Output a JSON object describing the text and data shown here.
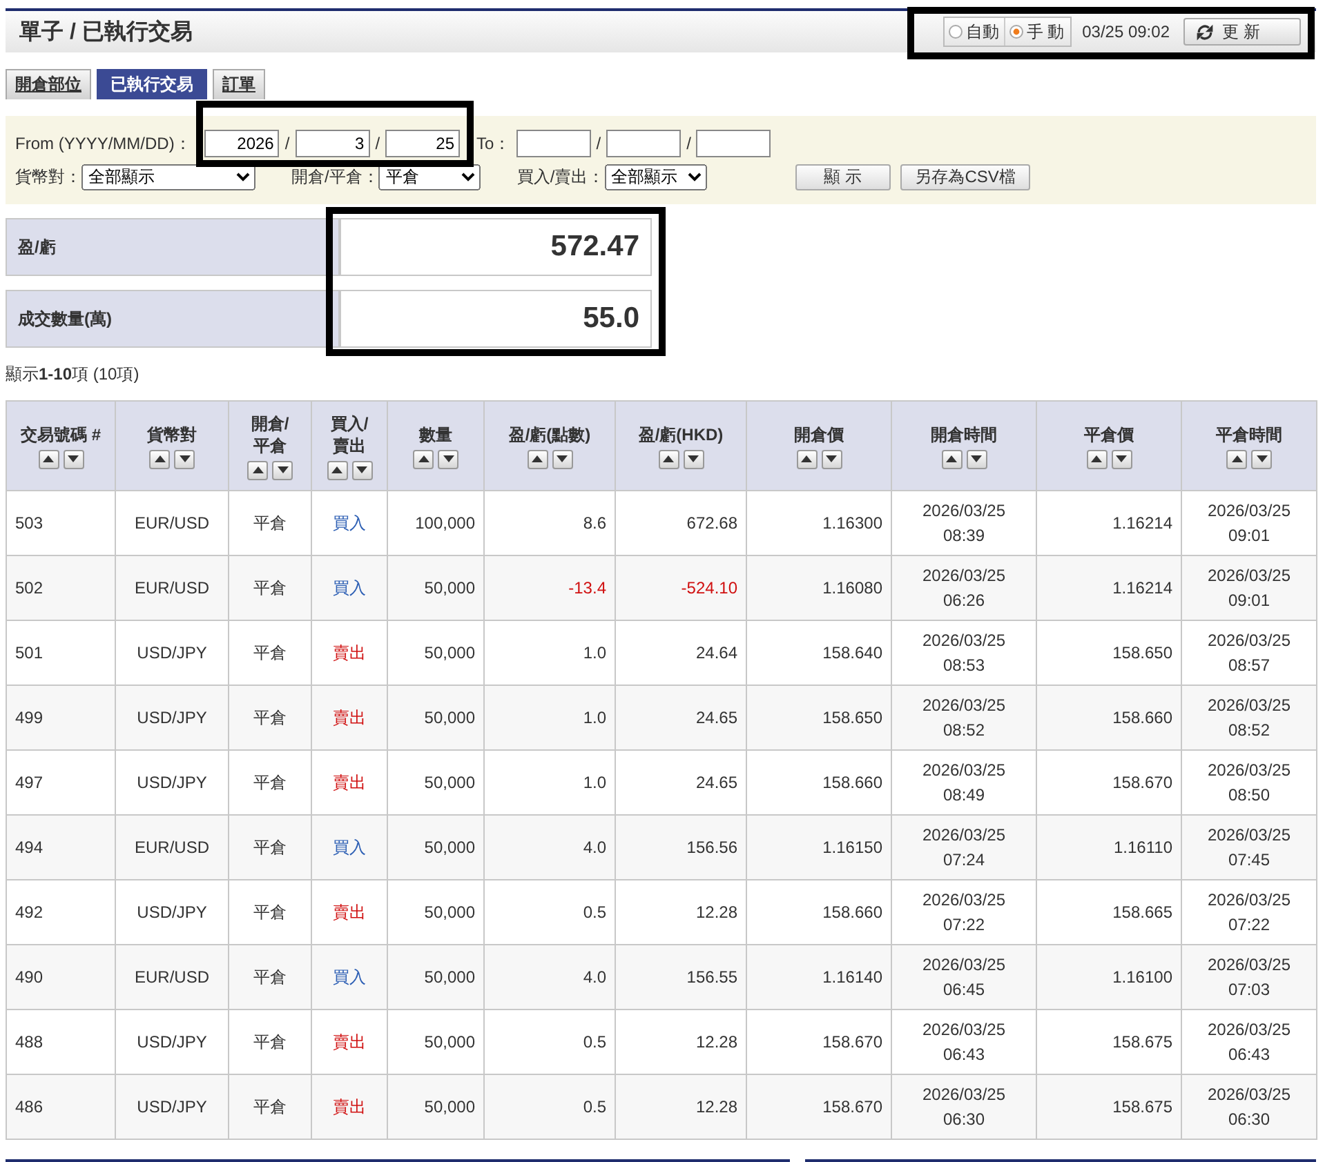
{
  "header": {
    "title": "單子 / 已執行交易",
    "controls": {
      "highlighted": true,
      "refresh_mode": [
        {
          "label": "自動",
          "selected": false
        },
        {
          "label": "手 動",
          "selected": true
        }
      ],
      "timestamp": "03/25 09:02",
      "refresh_button": "更 新"
    }
  },
  "tabs": [
    {
      "label": "開倉部位",
      "selected": false
    },
    {
      "label": "已執行交易",
      "selected": true
    },
    {
      "label": "訂單",
      "selected": false
    }
  ],
  "filter": {
    "from": {
      "label": "From (YYYY/MM/DD)：",
      "highlighted": true,
      "values": [
        "2026",
        "3",
        "25"
      ],
      "separators": [
        "/",
        "/"
      ]
    },
    "to": {
      "label": "To：",
      "separators": [
        "/",
        "/"
      ]
    },
    "selects": [
      {
        "label": "貨幣對：",
        "value": "全部顯示"
      },
      {
        "label": "開倉/平倉：",
        "value": "平倉"
      },
      {
        "label": "買入/賣出：",
        "value": "全部顯示"
      }
    ],
    "buttons": [
      "顯 示",
      "另存為CSV檔"
    ]
  },
  "summary": {
    "highlighted": true,
    "rows": [
      {
        "label": "盈/虧",
        "value": "572.47"
      },
      {
        "label": "成交數量(萬)",
        "value": "55.0"
      }
    ]
  },
  "count": "顯示**1-10**項 (10項)",
  "table": {
    "columns": [
      "交易號碼 #",
      "貨幣對",
      "開倉/\n平倉",
      "買入/\n賣出",
      "數量",
      "盈/虧(點數)",
      "盈/虧(HKD)",
      "開倉價",
      "開倉時間",
      "平倉價",
      "平倉時間"
    ],
    "rows": [
      {
        "id": "503",
        "pair": "EUR/USD",
        "open_close": "平倉",
        "side": {
          "kind": "buy",
          "text": "買入"
        },
        "quantity": "100,000",
        "pips": "8.6",
        "hkd": "672.68",
        "open_price": "1.16300",
        "open_time": "2026/03/25\n08:39",
        "close_price": "1.16214",
        "close_time": "2026/03/25\n09:01",
        "loss": false
      },
      {
        "id": "502",
        "pair": "EUR/USD",
        "open_close": "平倉",
        "side": {
          "kind": "buy",
          "text": "買入"
        },
        "quantity": "50,000",
        "pips": "-13.4",
        "hkd": "-524.10",
        "open_price": "1.16080",
        "open_time": "2026/03/25\n06:26",
        "close_price": "1.16214",
        "close_time": "2026/03/25\n09:01",
        "loss": true
      },
      {
        "id": "501",
        "pair": "USD/JPY",
        "open_close": "平倉",
        "side": {
          "kind": "sell",
          "text": "賣出"
        },
        "quantity": "50,000",
        "pips": "1.0",
        "hkd": "24.64",
        "open_price": "158.640",
        "open_time": "2026/03/25\n08:53",
        "close_price": "158.650",
        "close_time": "2026/03/25\n08:57",
        "loss": false
      },
      {
        "id": "499",
        "pair": "USD/JPY",
        "open_close": "平倉",
        "side": {
          "kind": "sell",
          "text": "賣出"
        },
        "quantity": "50,000",
        "pips": "1.0",
        "hkd": "24.65",
        "open_price": "158.650",
        "open_time": "2026/03/25\n08:52",
        "close_price": "158.660",
        "close_time": "2026/03/25\n08:52",
        "loss": false
      },
      {
        "id": "497",
        "pair": "USD/JPY",
        "open_close": "平倉",
        "side": {
          "kind": "sell",
          "text": "賣出"
        },
        "quantity": "50,000",
        "pips": "1.0",
        "hkd": "24.65",
        "open_price": "158.660",
        "open_time": "2026/03/25\n08:49",
        "close_price": "158.670",
        "close_time": "2026/03/25\n08:50",
        "loss": false
      },
      {
        "id": "494",
        "pair": "EUR/USD",
        "open_close": "平倉",
        "side": {
          "kind": "buy",
          "text": "買入"
        },
        "quantity": "50,000",
        "pips": "4.0",
        "hkd": "156.56",
        "open_price": "1.16150",
        "open_time": "2026/03/25\n07:24",
        "close_price": "1.16110",
        "close_time": "2026/03/25\n07:45",
        "loss": false
      },
      {
        "id": "492",
        "pair": "USD/JPY",
        "open_close": "平倉",
        "side": {
          "kind": "sell",
          "text": "賣出"
        },
        "quantity": "50,000",
        "pips": "0.5",
        "hkd": "12.28",
        "open_price": "158.660",
        "open_time": "2026/03/25\n07:22",
        "close_price": "158.665",
        "close_time": "2026/03/25\n07:22",
        "loss": false
      },
      {
        "id": "490",
        "pair": "EUR/USD",
        "open_close": "平倉",
        "side": {
          "kind": "buy",
          "text": "買入"
        },
        "quantity": "50,000",
        "pips": "4.0",
        "hkd": "156.55",
        "open_price": "1.16140",
        "open_time": "2026/03/25\n06:45",
        "close_price": "1.16100",
        "close_time": "2026/03/25\n07:03",
        "loss": false
      },
      {
        "id": "488",
        "pair": "USD/JPY",
        "open_close": "平倉",
        "side": {
          "kind": "sell",
          "text": "賣出"
        },
        "quantity": "50,000",
        "pips": "0.5",
        "hkd": "12.28",
        "open_price": "158.670",
        "open_time": "2026/03/25\n06:43",
        "close_price": "158.675",
        "close_time": "2026/03/25\n06:43",
        "loss": false
      },
      {
        "id": "486",
        "pair": "USD/JPY",
        "open_close": "平倉",
        "side": {
          "kind": "sell",
          "text": "賣出"
        },
        "quantity": "50,000",
        "pips": "0.5",
        "hkd": "12.28",
        "open_price": "158.670",
        "open_time": "2026/03/25\n06:30",
        "close_price": "158.675",
        "close_time": "2026/03/25\n06:30",
        "loss": false
      }
    ]
  }
}
